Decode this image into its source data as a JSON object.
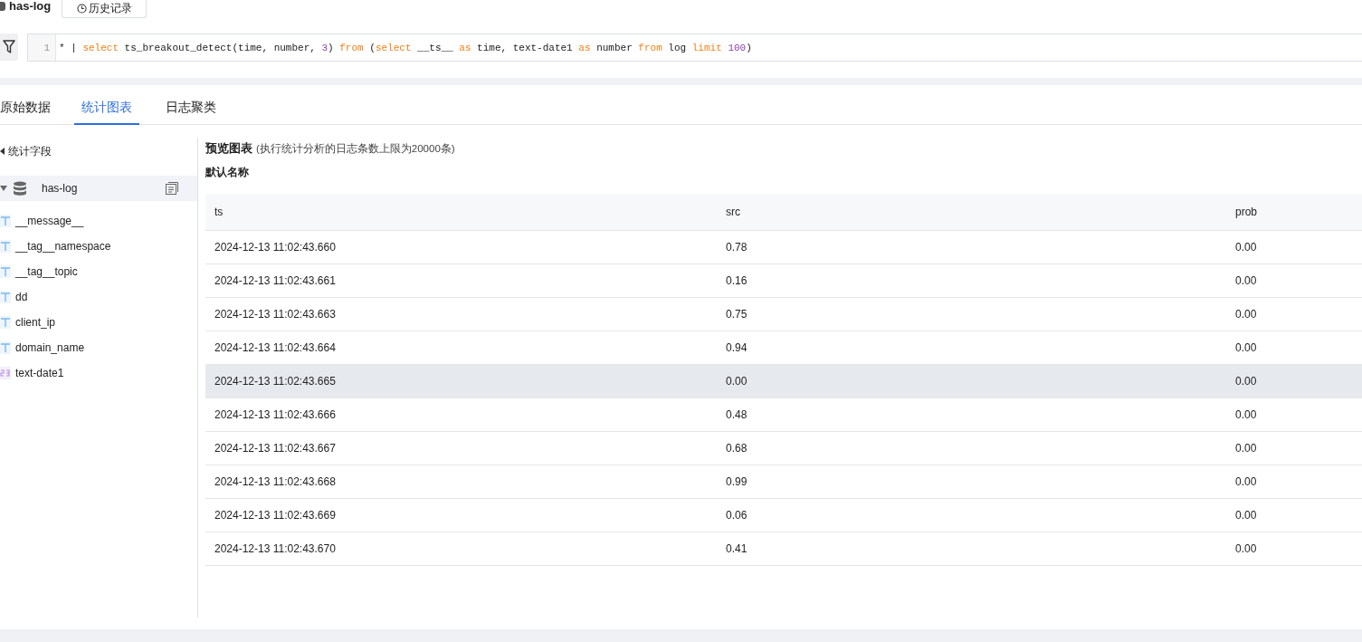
{
  "header": {
    "logstore": "has-log",
    "history_button": "历史记录"
  },
  "query": {
    "line_number": "1",
    "tokens": [
      {
        "text": "* | ",
        "kind": "plain"
      },
      {
        "text": "select",
        "kind": "keyword"
      },
      {
        "text": " ts_breakout_detect(time, number, ",
        "kind": "plain"
      },
      {
        "text": "3",
        "kind": "number"
      },
      {
        "text": ") ",
        "kind": "plain"
      },
      {
        "text": "from",
        "kind": "keyword"
      },
      {
        "text": " (",
        "kind": "plain"
      },
      {
        "text": "select",
        "kind": "keyword"
      },
      {
        "text": " __ts__ ",
        "kind": "plain"
      },
      {
        "text": "as",
        "kind": "keyword"
      },
      {
        "text": " time, text-date1 ",
        "kind": "plain"
      },
      {
        "text": "as",
        "kind": "keyword"
      },
      {
        "text": " number ",
        "kind": "plain"
      },
      {
        "text": "from",
        "kind": "keyword"
      },
      {
        "text": " log ",
        "kind": "plain"
      },
      {
        "text": "limit",
        "kind": "keyword"
      },
      {
        "text": " 100",
        "kind": "number"
      },
      {
        "text": ")",
        "kind": "plain"
      }
    ]
  },
  "tabs": [
    {
      "label": "原始数据",
      "selected": false
    },
    {
      "label": "统计图表",
      "selected": true
    },
    {
      "label": "日志聚类",
      "selected": false
    }
  ],
  "sidebar": {
    "title": "统计字段",
    "source": {
      "name": "has-log",
      "expanded": true
    },
    "fields": [
      {
        "name": "__message__",
        "kind": "text"
      },
      {
        "name": "__tag__namespace",
        "kind": "text"
      },
      {
        "name": "__tag__topic",
        "kind": "text"
      },
      {
        "name": "dd",
        "kind": "text"
      },
      {
        "name": "client_ip",
        "kind": "text"
      },
      {
        "name": "domain_name",
        "kind": "text"
      },
      {
        "name": "text-date1",
        "kind": "number"
      }
    ]
  },
  "preview": {
    "title": "预览图表",
    "note": "(执行统计分析的日志条数上限为20000条)",
    "chart_name": "默认名称"
  },
  "table": {
    "columns": [
      "ts",
      "src",
      "prob"
    ],
    "rows": [
      {
        "cells": [
          "2024-12-13 11:02:43.660",
          "0.78",
          "0.00"
        ],
        "highlighted": false
      },
      {
        "cells": [
          "2024-12-13 11:02:43.661",
          "0.16",
          "0.00"
        ],
        "highlighted": false
      },
      {
        "cells": [
          "2024-12-13 11:02:43.663",
          "0.75",
          "0.00"
        ],
        "highlighted": false
      },
      {
        "cells": [
          "2024-12-13 11:02:43.664",
          "0.94",
          "0.00"
        ],
        "highlighted": false
      },
      {
        "cells": [
          "2024-12-13 11:02:43.665",
          "0.00",
          "0.00"
        ],
        "highlighted": true
      },
      {
        "cells": [
          "2024-12-13 11:02:43.666",
          "0.48",
          "0.00"
        ],
        "highlighted": false
      },
      {
        "cells": [
          "2024-12-13 11:02:43.667",
          "0.68",
          "0.00"
        ],
        "highlighted": false
      },
      {
        "cells": [
          "2024-12-13 11:02:43.668",
          "0.99",
          "0.00"
        ],
        "highlighted": false
      },
      {
        "cells": [
          "2024-12-13 11:02:43.669",
          "0.06",
          "0.00"
        ],
        "highlighted": false
      },
      {
        "cells": [
          "2024-12-13 11:02:43.670",
          "0.41",
          "0.00"
        ],
        "highlighted": false
      }
    ]
  }
}
